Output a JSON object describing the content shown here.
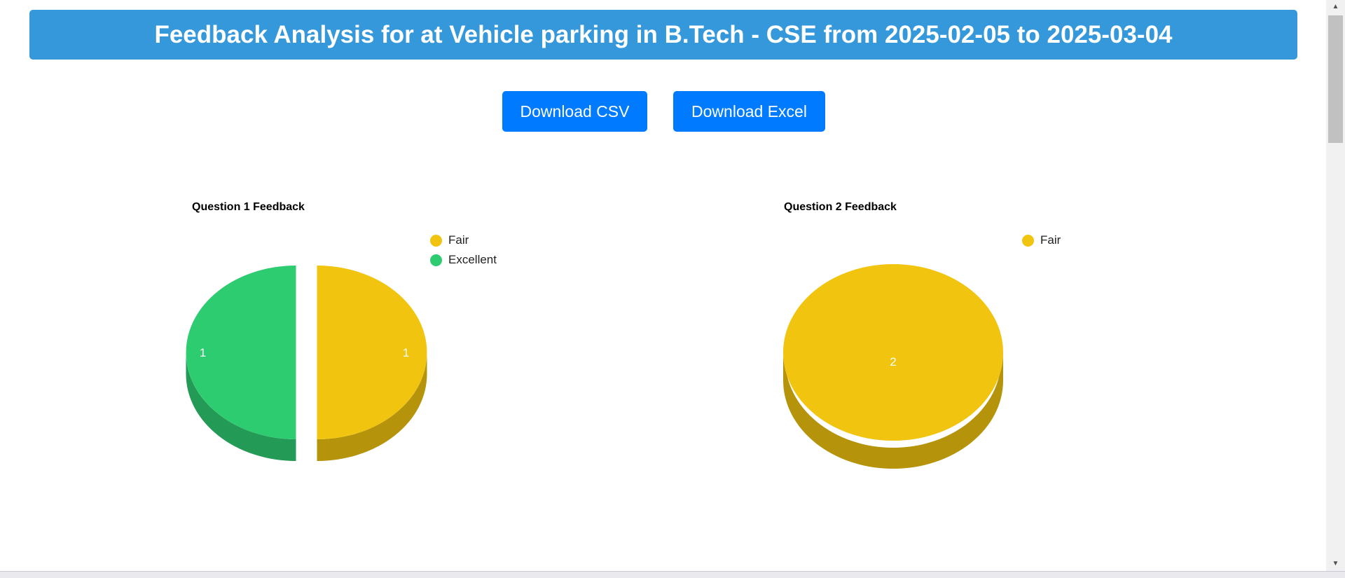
{
  "header": {
    "title": "Feedback Analysis for at Vehicle parking in B.Tech - CSE from 2025-02-05 to 2025-03-04"
  },
  "actions": {
    "csv_label": "Download CSV",
    "excel_label": "Download Excel"
  },
  "colors": {
    "header_bg": "#3498db",
    "button_bg": "#007bff",
    "Fair": "#f1c40f",
    "Excellent": "#2ecc71"
  },
  "chart_data": [
    {
      "type": "pie",
      "title": "Question 1 Feedback",
      "style": "3d",
      "legend_position": "top-right",
      "categories": [
        "Fair",
        "Excellent"
      ],
      "values": [
        1,
        1
      ],
      "data_labels": [
        "1",
        "1"
      ]
    },
    {
      "type": "pie",
      "title": "Question 2 Feedback",
      "style": "3d",
      "legend_position": "top-right",
      "categories": [
        "Fair"
      ],
      "values": [
        2
      ],
      "data_labels": [
        "2"
      ]
    }
  ]
}
